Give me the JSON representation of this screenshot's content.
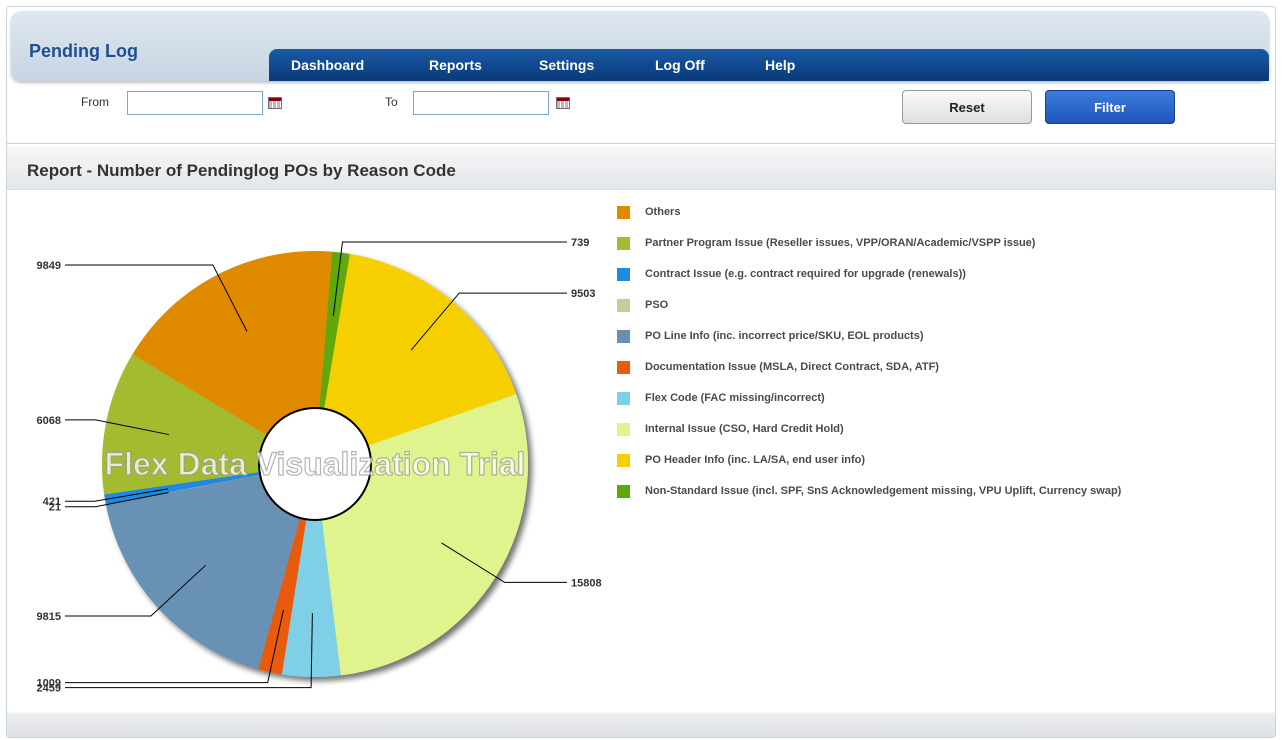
{
  "app": {
    "title": "Pending Log"
  },
  "nav": {
    "items": [
      "Dashboard",
      "Reports",
      "Settings",
      "Log Off",
      "Help"
    ]
  },
  "filter": {
    "from_label": "From",
    "to_label": "To",
    "from_value": "",
    "to_value": "",
    "reset_label": "Reset",
    "filter_label": "Filter"
  },
  "report": {
    "title": "Report - Number of Pendinglog POs by Reason Code",
    "watermark": "Flex Data Visualization Trial"
  },
  "chart_data": {
    "type": "pie",
    "variant": "donut",
    "title": "Report - Number of Pendinglog POs by Reason Code",
    "legend_position": "right",
    "series": [
      {
        "name": "Others",
        "value": 9849,
        "label": "9849",
        "color": "#e08a00"
      },
      {
        "name": "Non-Standard Issue (incl. SPF, SnS Acknowledgement missing, VPU Uplift, Currency swap)",
        "value": 739,
        "label": "739",
        "color": "#5fa80c"
      },
      {
        "name": "PO Header Info (inc. LA/SA, end user info)",
        "value": 9503,
        "label": "9503",
        "color": "#f6cf00"
      },
      {
        "name": "Internal Issue (CSO, Hard Credit Hold)",
        "value": 15808,
        "label": "15808",
        "color": "#dff48c"
      },
      {
        "name": "Flex Code (FAC missing/incorrect)",
        "value": 2459,
        "label": "2459",
        "color": "#7fd0e6"
      },
      {
        "name": "Documentation Issue (MSLA, Direct Contract, SDA, ATF)",
        "value": 1009,
        "label": "1009",
        "color": "#ea5a0a"
      },
      {
        "name": "PO Line Info (inc. incorrect price/SKU, EOL products)",
        "value": 9815,
        "label": "9815",
        "color": "#6791b4"
      },
      {
        "name": "PSO",
        "value": 21,
        "label": "21",
        "color": "#c9c99a"
      },
      {
        "name": "Contract Issue (e.g. contract required for upgrade (renewals))",
        "value": 421,
        "label": "421",
        "color": "#1d8ae0"
      },
      {
        "name": "Partner Program Issue (Reseller issues, VPP/ORAN/Academic/VSPP issue)",
        "value": 6068,
        "label": "6068",
        "color": "#a3bb2d"
      }
    ],
    "legend": [
      {
        "label": "Others",
        "color": "#e08a00"
      },
      {
        "label": "Partner Program Issue (Reseller issues, VPP/ORAN/Academic/VSPP issue)",
        "color": "#a3bb2d"
      },
      {
        "label": "Contract Issue (e.g. contract required for upgrade (renewals))",
        "color": "#1d8ae0"
      },
      {
        "label": "PSO",
        "color": "#c9c99a"
      },
      {
        "label": "PO Line Info (inc. incorrect price/SKU, EOL products)",
        "color": "#6791b4"
      },
      {
        "label": "Documentation Issue (MSLA, Direct Contract, SDA, ATF)",
        "color": "#ea5a0a"
      },
      {
        "label": "Flex Code (FAC missing/incorrect)",
        "color": "#7fd0e6"
      },
      {
        "label": "Internal Issue (CSO, Hard Credit Hold)",
        "color": "#dff48c"
      },
      {
        "label": "PO Header Info (inc. LA/SA, end user info)",
        "color": "#f6cf00"
      },
      {
        "label": "Non-Standard Issue (incl. SPF, SnS Acknowledgement missing, VPU Uplift, Currency swap)",
        "color": "#5fa80c"
      }
    ]
  }
}
